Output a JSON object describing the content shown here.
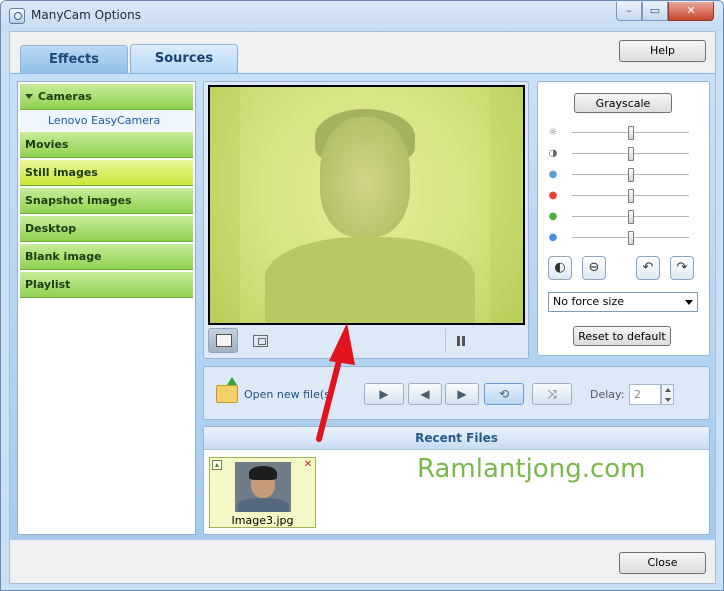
{
  "window": {
    "title": "ManyCam Options",
    "close_glyph": "✕",
    "min_glyph": "–",
    "max_glyph": "▭"
  },
  "tabs": [
    {
      "label": "Effects",
      "active": false
    },
    {
      "label": "Sources",
      "active": true
    }
  ],
  "help_label": "Help",
  "sidebar": {
    "items": [
      {
        "label": "Cameras",
        "expanded": true
      },
      {
        "label": "Lenovo EasyCamera",
        "sub": true
      },
      {
        "label": "Movies"
      },
      {
        "label": "Still images",
        "active": true
      },
      {
        "label": "Snapshot images"
      },
      {
        "label": "Desktop"
      },
      {
        "label": "Blank image"
      },
      {
        "label": "Playlist"
      }
    ]
  },
  "adjust": {
    "grayscale_label": "Grayscale",
    "sliders": [
      {
        "icon": "brightness-icon",
        "glyph": "☼",
        "color": "#666666",
        "value": 0.5
      },
      {
        "icon": "contrast-icon",
        "glyph": "◑",
        "color": "#666666",
        "value": 0.5
      },
      {
        "icon": "saturation-icon",
        "glyph": "●",
        "color": "#5a9fd4",
        "value": 0.5
      },
      {
        "icon": "red-icon",
        "glyph": "●",
        "color": "#e8412c",
        "value": 0.5
      },
      {
        "icon": "green-icon",
        "glyph": "●",
        "color": "#49b23a",
        "value": 0.5
      },
      {
        "icon": "blue-icon",
        "glyph": "●",
        "color": "#4a8fe0",
        "value": 0.5
      }
    ],
    "force_size_value": "No force size",
    "reset_label": "Reset to default"
  },
  "playback": {
    "open_label": "Open new file(s)",
    "delay_label": "Delay:",
    "delay_value": "2"
  },
  "recent": {
    "header": "Recent Files",
    "files": [
      {
        "name": "Image3.jpg"
      }
    ],
    "watermark": "Ramlantjong.com"
  },
  "close_label": "Close"
}
